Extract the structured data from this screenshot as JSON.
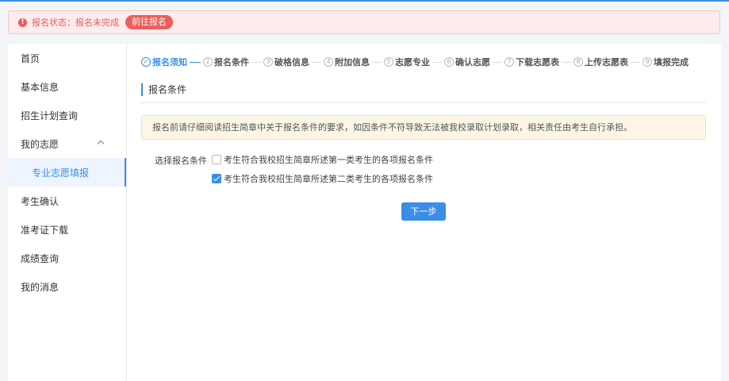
{
  "status": {
    "icon": "warning-circle-icon",
    "text": "报名状态：报名未完成",
    "button": "前往报名"
  },
  "sidebar": {
    "items": [
      {
        "label": "首页"
      },
      {
        "label": "基本信息"
      },
      {
        "label": "招生计划查询"
      },
      {
        "label": "我的志愿"
      },
      {
        "label": "专业志愿填报"
      },
      {
        "label": "考生确认"
      },
      {
        "label": "准考证下载"
      },
      {
        "label": "成绩查询"
      },
      {
        "label": "我的消息"
      }
    ]
  },
  "steps": [
    {
      "num": "✓",
      "label": "报名须知"
    },
    {
      "num": "2",
      "label": "报名条件"
    },
    {
      "num": "3",
      "label": "破格信息"
    },
    {
      "num": "4",
      "label": "附加信息"
    },
    {
      "num": "5",
      "label": "志愿专业"
    },
    {
      "num": "6",
      "label": "确认志愿"
    },
    {
      "num": "7",
      "label": "下载志愿表"
    },
    {
      "num": "8",
      "label": "上传志愿表"
    },
    {
      "num": "9",
      "label": "填报完成"
    }
  ],
  "section": {
    "title": "报名条件",
    "notice": "报名前请仔细阅读招生简章中关于报名条件的要求，如因条件不符导致无法被我校录取计划录取，相关责任由考生自行承担。",
    "condition_label": "选择报名条件",
    "options": [
      {
        "label": "考生符合我校招生简章所述第一类考生的各项报名条件",
        "checked": false
      },
      {
        "label": "考生符合我校招生简章所述第二类考生的各项报名条件",
        "checked": true
      }
    ],
    "next_button": "下一步"
  },
  "colors": {
    "primary": "#3a8ee6",
    "alert": "#e85c5c",
    "notice_bg": "#fdf6e6"
  }
}
